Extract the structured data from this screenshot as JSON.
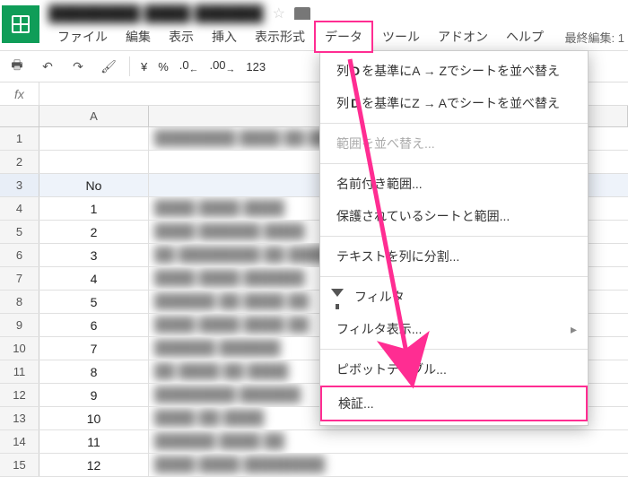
{
  "doc_title": "████████ ████ ██████",
  "menubar": {
    "file": "ファイル",
    "edit": "編集",
    "view": "表示",
    "insert": "挿入",
    "format": "表示形式",
    "data": "データ",
    "tools": "ツール",
    "addons": "アドオン",
    "help": "ヘルプ",
    "lastedit": "最終編集: 1"
  },
  "toolbar": {
    "yen": "¥",
    "percent": "%",
    "dec_dec": ".0",
    "dec_inc": ".00",
    "num123": "123"
  },
  "fx": "fx",
  "columns": {
    "A": "A"
  },
  "rows": {
    "r1": "1",
    "r2": "2",
    "r3": "3",
    "r4": "4",
    "r5": "5",
    "r6": "6",
    "r7": "7",
    "r8": "8",
    "r9": "9",
    "r10": "10",
    "r11": "11",
    "r12": "12",
    "r13": "13",
    "r14": "14",
    "r15": "15"
  },
  "cells": {
    "a3_header": "No",
    "a4": "1",
    "a5": "2",
    "a6": "3",
    "a7": "4",
    "a8": "5",
    "a9": "6",
    "a10": "7",
    "a11": "8",
    "a12": "9",
    "a13": "10",
    "a14": "11",
    "a15": "12"
  },
  "dropdown": {
    "sort_az_pre": "列 ",
    "sort_col": "D",
    "sort_az_post": " を基準にA → Zでシートを並べ替え",
    "sort_za_post": " を基準にZ → Aでシートを並べ替え",
    "sort_range": "範囲を並べ替え...",
    "named_range": "名前付き範囲...",
    "protected": "保護されているシートと範囲...",
    "split_text": "テキストを列に分割...",
    "filter": "フィルタ",
    "filter_views": "フィルタ表示...",
    "pivot": "ピボットテーブル...",
    "validation": "検証..."
  }
}
